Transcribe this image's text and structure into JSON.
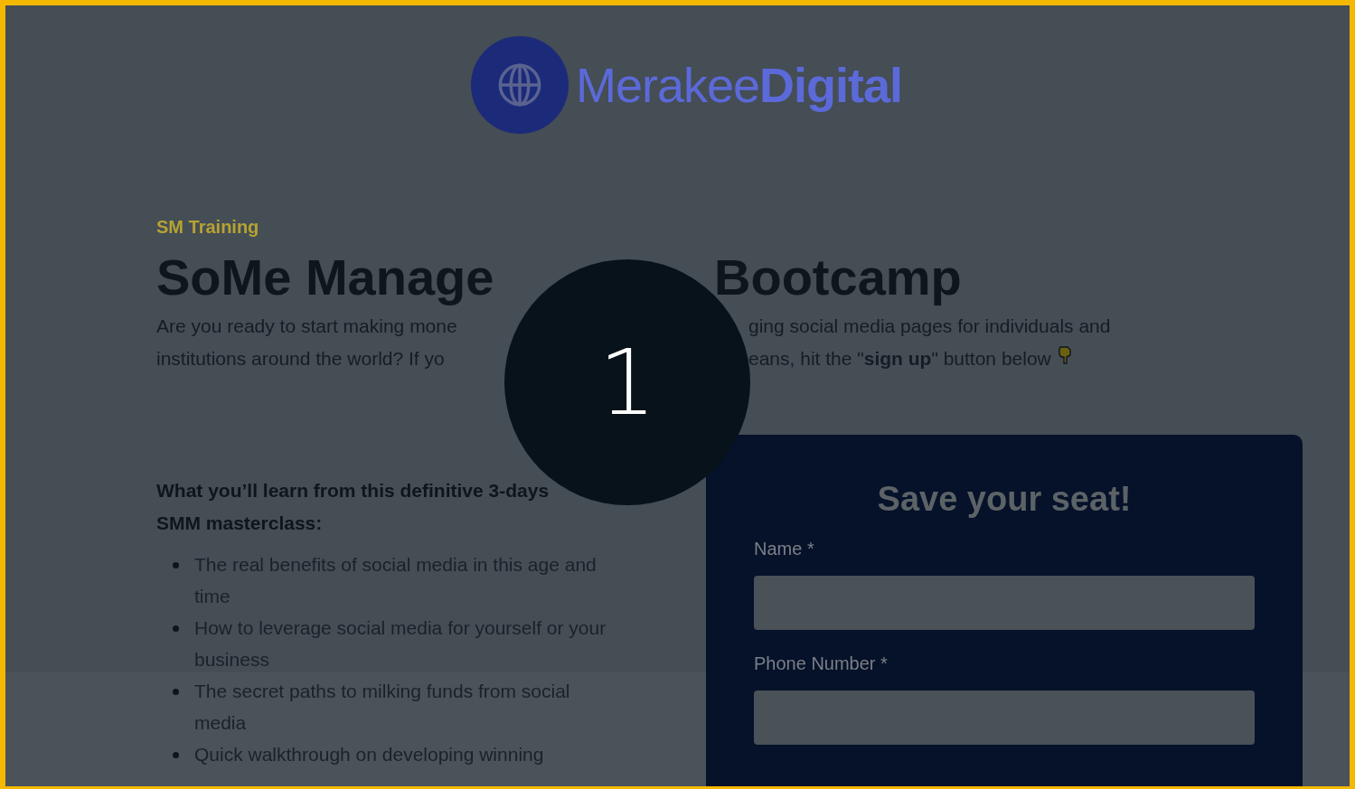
{
  "logo": {
    "text": "Merakee**Digital**"
  },
  "step_marker": {
    "label": "1"
  },
  "hero": {
    "eyebrow": "SM Training",
    "title_parts": [
      "SoMe Manage",
      "Bootcamp"
    ],
    "intro_lines": [
      [
        "Are you ready to start making mone",
        "ging social media pages for individuals and"
      ],
      [
        "institutions around the world? If yo",
        "eans, hit the \"**sign up**\" button below"
      ]
    ]
  },
  "learn": {
    "heading": "What you’ll learn from this definitive 3-days SMM masterclass:",
    "items": [
      "The real benefits of social media in this age and time",
      "How to leverage social media for yourself or your business",
      "The secret paths to milking funds from social media",
      "Quick walkthrough on developing winning"
    ]
  },
  "signup_form": {
    "title": "Save your seat!",
    "fields": [
      {
        "label": "Name *"
      },
      {
        "label": "Phone Number *"
      }
    ]
  }
}
